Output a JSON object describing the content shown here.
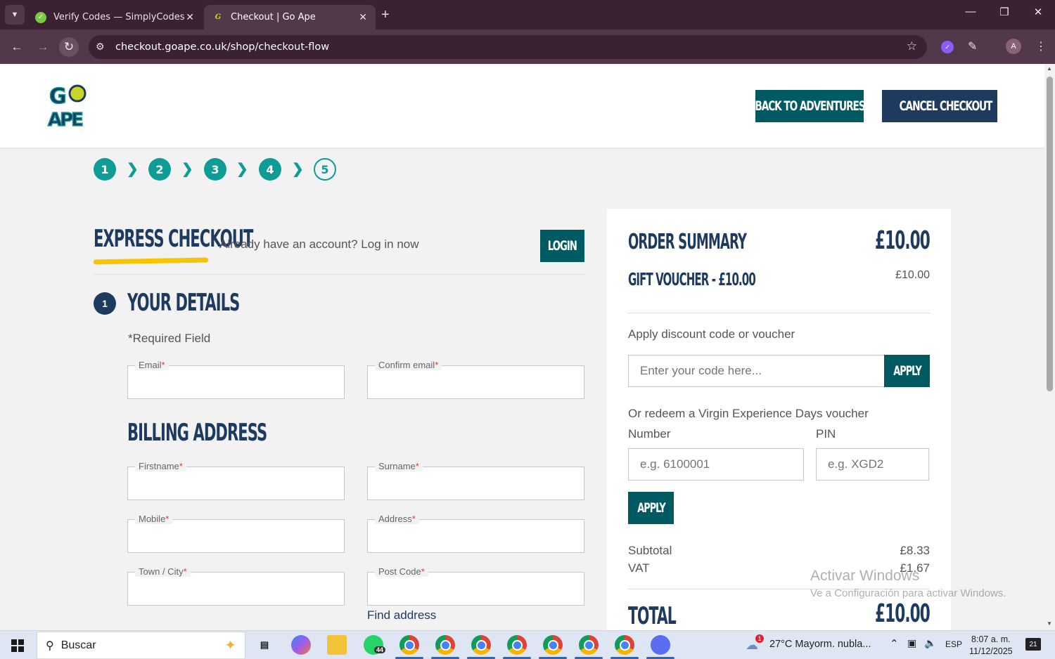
{
  "browser": {
    "tabs": [
      {
        "title": "Verify Codes — SimplyCodes",
        "active": false
      },
      {
        "title": "Checkout | Go Ape",
        "active": true
      }
    ],
    "url": "checkout.goape.co.uk/shop/checkout-flow",
    "profile_initial": "A"
  },
  "header": {
    "logo_text": "GO APE",
    "back_label": "BACK TO ADVENTURES",
    "cancel_label": "CANCEL CHECKOUT",
    "colors": {
      "teal": "#005a62",
      "navy": "#1f3a5f",
      "step_teal": "#0e9c97",
      "yellow": "#f7c500"
    }
  },
  "steps": [
    "1",
    "2",
    "3",
    "4",
    "5"
  ],
  "express": {
    "title": "EXPRESS CHECKOUT",
    "account_prompt": "Already have an account? Log in now",
    "login_label": "LOGIN"
  },
  "details": {
    "step_number": "1",
    "title": "YOUR DETAILS",
    "required_note": "*Required Field",
    "email_label": "Email",
    "confirm_email_label": "Confirm email"
  },
  "billing": {
    "title": "BILLING ADDRESS",
    "firstname_label": "Firstname",
    "surname_label": "Surname",
    "mobile_label": "Mobile",
    "address_label": "Address",
    "town_label": "Town / City",
    "postcode_label": "Post Code",
    "find_address": "Find address",
    "required_mark": "*"
  },
  "summary": {
    "title": "ORDER SUMMARY",
    "total_top": "£10.00",
    "item_label": "GIFT VOUCHER - £10.00",
    "item_price": "£10.00",
    "discount_label": "Apply discount code or voucher",
    "code_placeholder": "Enter your code here...",
    "apply_label": "APPLY",
    "redeem_label": "Or redeem a Virgin Experience Days voucher",
    "number_label": "Number",
    "pin_label": "PIN",
    "number_placeholder": "e.g. 6100001",
    "pin_placeholder": "e.g. XGD2",
    "subtotal_label": "Subtotal",
    "subtotal_value": "£8.33",
    "vat_label": "VAT",
    "vat_value": "£1.67",
    "total_label": "TOTAL",
    "total_value": "£10.00"
  },
  "watermark": {
    "line1": "Activar Windows",
    "line2": "Ve a Configuración para activar Windows."
  },
  "taskbar": {
    "search_placeholder": "Buscar",
    "whatsapp_badge": "44",
    "chrome_profiles": [
      "J",
      "M",
      "A",
      "A",
      "A",
      "S",
      "G"
    ],
    "weather": "27°C  Mayorm. nubla...",
    "weather_alert": "1",
    "language": "ESP",
    "time": "8:07 a. m.",
    "date": "11/12/2025",
    "notifications": "21"
  }
}
